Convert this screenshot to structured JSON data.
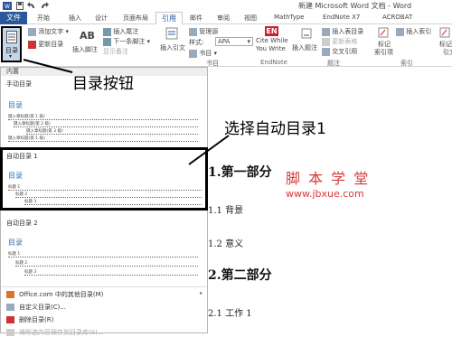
{
  "window": {
    "title": "新建 Microsoft Word 文档 - Word"
  },
  "tabs": [
    "文件",
    "开始",
    "插入",
    "设计",
    "页面布局",
    "引用",
    "邮件",
    "审阅",
    "视图",
    "MathType",
    "EndNote X7",
    "ACROBAT"
  ],
  "ribbon": {
    "toc": "目录",
    "add_text": "添加文字",
    "update_toc": "更新目录",
    "footnote_big": "AB",
    "insert_footnote": "插入脚注",
    "insert_endnote": "插入尾注",
    "next_footnote": "下一条脚注",
    "show_notes": "显示备注",
    "insert_citation": "插入引文",
    "manage_sources": "管理源",
    "style_label": "样式:",
    "style_value": "APA",
    "bibliography": "书目",
    "group_biblio": "书目",
    "cite_en": "EN",
    "cite_label_1": "Cite While",
    "cite_label_2": "You Write",
    "group_endnote": "EndNote",
    "insert_caption": "插入题注",
    "insert_table_of_figures": "插入表目录",
    "update_table": "更新表格",
    "cross_reference": "交叉引用",
    "group_caption": "题注",
    "mark_entry_1": "标记",
    "mark_entry_2": "索引项",
    "insert_index": "插入索引",
    "group_index": "索引",
    "mark_citation_1": "标记",
    "mark_citation_2": "引文"
  },
  "dropdown": {
    "builtin": "内置",
    "manual_label": "手动目录",
    "manual_title": "目录",
    "manual_lines": [
      "键入章标题(第 1 级)",
      "键入章标题(第 2 级)",
      "键入章标题(第 3 级)",
      "键入章标题(第 1 级)"
    ],
    "auto1_label": "自动目录 1",
    "auto1_title": "目录",
    "auto1_lines": [
      "标题 1",
      "标题 2",
      "标题 3"
    ],
    "auto2_label": "自动目录 2",
    "auto2_title": "目录",
    "auto2_lines": [
      "标题 1",
      "标题 2",
      "标题 3"
    ],
    "menu": [
      "Office.com 中的其他目录(M)",
      "自定义目录(C)...",
      "删除目录(R)",
      "将所选内容保存到目录库(S)..."
    ]
  },
  "annotations": {
    "toc_button": "目录按钮",
    "select_auto": "选择自动目录1"
  },
  "document": {
    "h1": "1.第一部分",
    "s11": "1.1 背景",
    "s12": "1.2 意义",
    "h2": "2.第二部分",
    "s21": "2.1 工作 1",
    "watermark_1": "脚 本 学 堂",
    "watermark_2": "www.jbxue.com"
  },
  "colors": {
    "accent": "#2b579a",
    "heading_blue": "#2e74b5",
    "watermark": "#d43a3a"
  }
}
